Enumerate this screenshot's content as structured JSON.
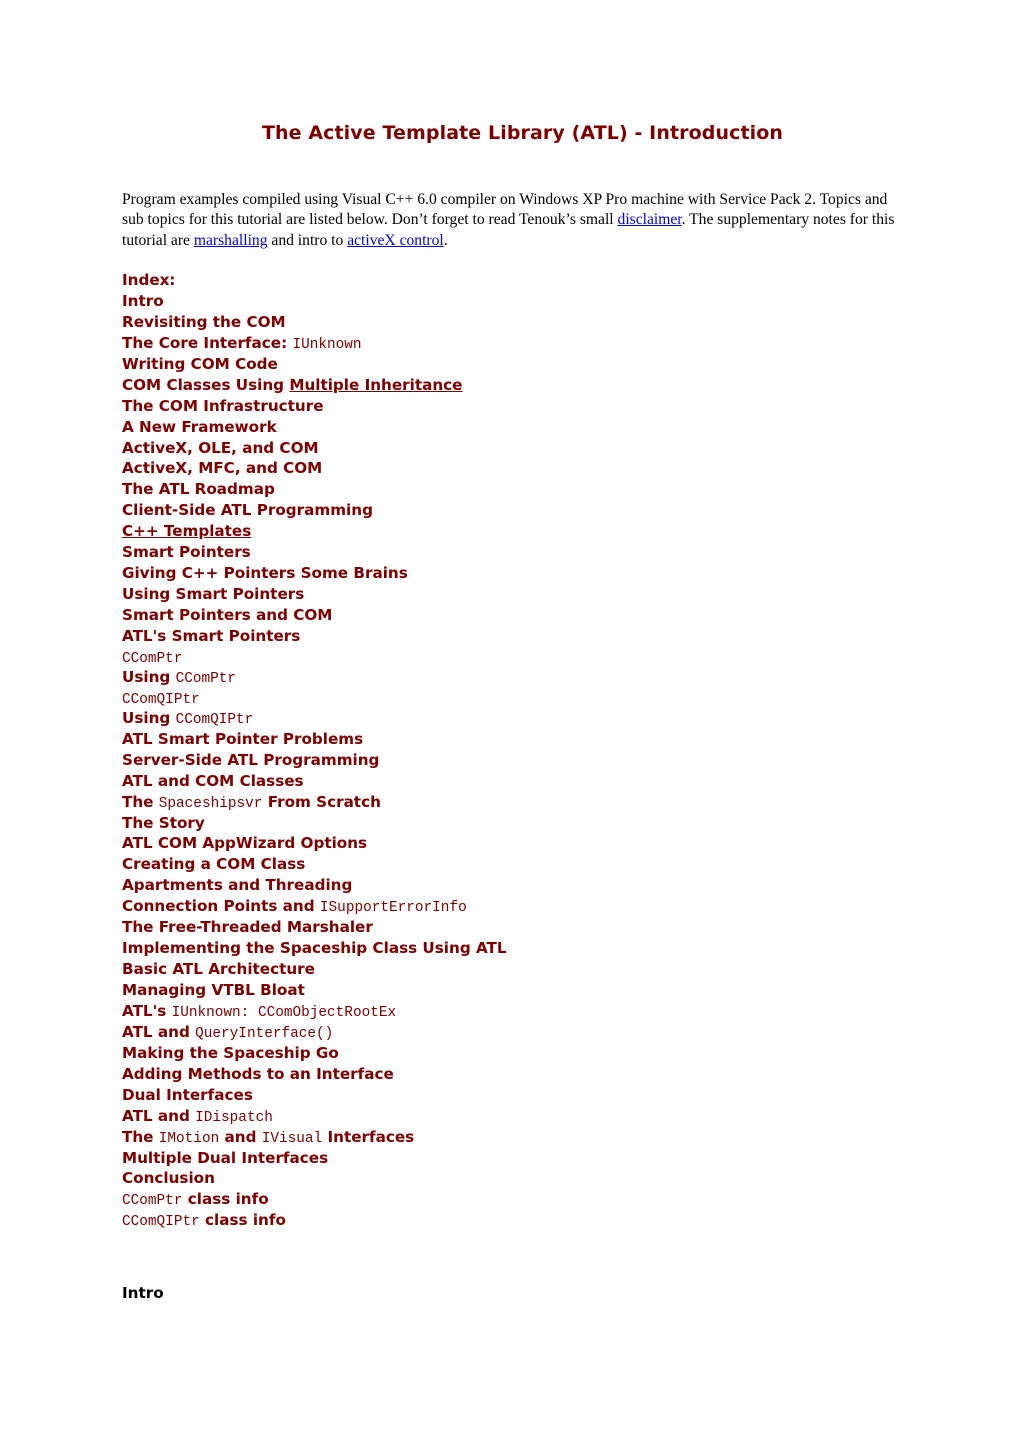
{
  "title": "The Active Template Library (ATL) - Introduction",
  "intro": {
    "text_1": "Program examples compiled using Visual C++ 6.0 compiler on Windows XP Pro machine with Service Pack 2. Topics and sub topics for this tutorial are listed below. Don’t forget to read Tenouk’s small ",
    "link_disclaimer": "disclaimer",
    "text_2": ". The supplementary notes for this tutorial are ",
    "link_marshalling": "marshalling",
    "text_3": " and intro to ",
    "link_activex": "activeX control",
    "text_4": "."
  },
  "index": {
    "heading": "Index:",
    "items": [
      {
        "parts": [
          {
            "t": "Intro"
          }
        ]
      },
      {
        "parts": [
          {
            "t": "Revisiting the COM"
          }
        ]
      },
      {
        "parts": [
          {
            "t": "The Core Interface: "
          },
          {
            "t": "IUnknown",
            "mono": true
          }
        ]
      },
      {
        "parts": [
          {
            "t": "Writing COM Code"
          }
        ]
      },
      {
        "parts": [
          {
            "t": "COM Classes Using "
          },
          {
            "t": "Multiple Inheritance",
            "ul": true
          }
        ]
      },
      {
        "parts": [
          {
            "t": "The COM Infrastructure"
          }
        ]
      },
      {
        "parts": [
          {
            "t": "A New Framework"
          }
        ]
      },
      {
        "parts": [
          {
            "t": "ActiveX, OLE, and COM"
          }
        ]
      },
      {
        "parts": [
          {
            "t": "ActiveX, MFC, and COM"
          }
        ]
      },
      {
        "parts": [
          {
            "t": "The ATL Roadmap"
          }
        ]
      },
      {
        "parts": [
          {
            "t": "Client-Side ATL Programming"
          }
        ]
      },
      {
        "parts": [
          {
            "t": "C++ Templates",
            "ul": true
          }
        ]
      },
      {
        "parts": [
          {
            "t": "Smart Pointers"
          }
        ]
      },
      {
        "parts": [
          {
            "t": "Giving C++ Pointers Some Brains"
          }
        ]
      },
      {
        "parts": [
          {
            "t": "Using Smart Pointers"
          }
        ]
      },
      {
        "parts": [
          {
            "t": "Smart Pointers and COM"
          }
        ]
      },
      {
        "parts": [
          {
            "t": "ATL's Smart Pointers"
          }
        ]
      },
      {
        "parts": [
          {
            "t": "CComPtr",
            "mono": true
          }
        ]
      },
      {
        "parts": [
          {
            "t": "Using "
          },
          {
            "t": "CComPtr",
            "mono": true
          }
        ]
      },
      {
        "parts": [
          {
            "t": "CComQIPtr",
            "mono": true
          }
        ]
      },
      {
        "parts": [
          {
            "t": "Using "
          },
          {
            "t": "CComQIPtr",
            "mono": true
          }
        ]
      },
      {
        "parts": [
          {
            "t": "ATL Smart Pointer Problems"
          }
        ]
      },
      {
        "parts": [
          {
            "t": "Server-Side ATL Programming"
          }
        ]
      },
      {
        "parts": [
          {
            "t": "ATL and COM Classes"
          }
        ]
      },
      {
        "parts": [
          {
            "t": "The "
          },
          {
            "t": "Spaceshipsvr",
            "mono": true
          },
          {
            "t": " From Scratch"
          }
        ]
      },
      {
        "parts": [
          {
            "t": "The Story"
          }
        ]
      },
      {
        "parts": [
          {
            "t": "ATL COM AppWizard Options"
          }
        ]
      },
      {
        "parts": [
          {
            "t": "Creating a COM Class"
          }
        ]
      },
      {
        "parts": [
          {
            "t": "Apartments and Threading"
          }
        ]
      },
      {
        "parts": [
          {
            "t": "Connection Points and "
          },
          {
            "t": "ISupportErrorInfo",
            "mono": true
          }
        ]
      },
      {
        "parts": [
          {
            "t": "The Free-Threaded Marshaler"
          }
        ]
      },
      {
        "parts": [
          {
            "t": "Implementing the Spaceship Class Using ATL"
          }
        ]
      },
      {
        "parts": [
          {
            "t": "Basic ATL Architecture"
          }
        ]
      },
      {
        "parts": [
          {
            "t": "Managing VTBL Bloat"
          }
        ]
      },
      {
        "parts": [
          {
            "t": "ATL's "
          },
          {
            "t": "IUnknown: CComObjectRootEx",
            "mono": true
          }
        ]
      },
      {
        "parts": [
          {
            "t": "ATL and "
          },
          {
            "t": "QueryInterface()",
            "mono": true
          }
        ]
      },
      {
        "parts": [
          {
            "t": "Making the Spaceship Go"
          }
        ]
      },
      {
        "parts": [
          {
            "t": "Adding Methods to an Interface"
          }
        ]
      },
      {
        "parts": [
          {
            "t": "Dual Interfaces"
          }
        ]
      },
      {
        "parts": [
          {
            "t": "ATL and "
          },
          {
            "t": "IDispatch",
            "mono": true
          }
        ]
      },
      {
        "parts": [
          {
            "t": "The "
          },
          {
            "t": "IMotion",
            "mono": true
          },
          {
            "t": " and "
          },
          {
            "t": "IVisual",
            "mono": true
          },
          {
            "t": " Interfaces"
          }
        ]
      },
      {
        "parts": [
          {
            "t": "Multiple Dual Interfaces"
          }
        ]
      },
      {
        "parts": [
          {
            "t": "Conclusion"
          }
        ]
      },
      {
        "parts": [
          {
            "t": "CComPtr",
            "mono": true
          },
          {
            "t": " class info"
          }
        ]
      },
      {
        "parts": [
          {
            "t": "CComQIPtr",
            "mono": true
          },
          {
            "t": " class info"
          }
        ]
      }
    ]
  },
  "section_heading": "Intro",
  "colors": {
    "heading": "#800000",
    "link": "#0000ee",
    "text": "#000000"
  }
}
